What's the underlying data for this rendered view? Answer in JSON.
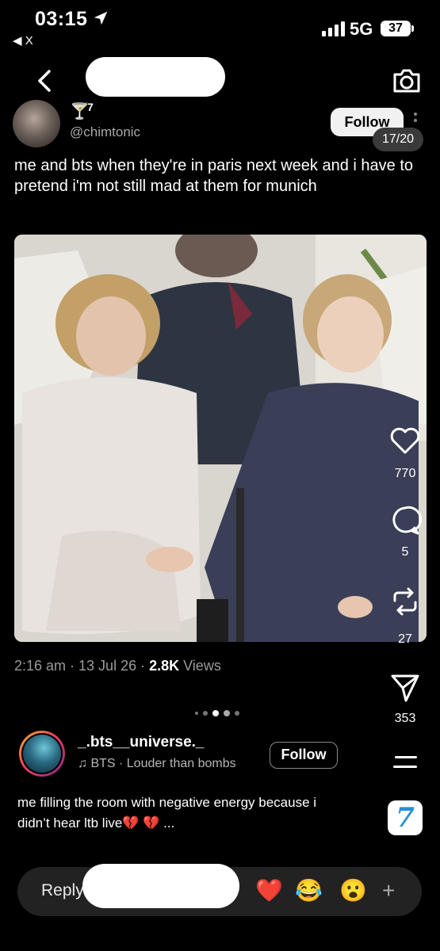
{
  "status_bar": {
    "time": "03:15",
    "back_app": "◀ X",
    "network": "5G",
    "battery": "37"
  },
  "header": {
    "back_icon": "chevron-left-icon",
    "camera_icon": "camera-icon"
  },
  "post": {
    "badge_emoji": "🍸",
    "badge_count": "7",
    "handle": "@chimtonic",
    "follow_label": "Follow",
    "counter": "17/20",
    "caption": "me and bts when they're in paris next week and i have to pretend i'm not still mad at them for munich",
    "timestamp": "2:16 am · 13 Jul 26 · ",
    "views_count": "2.8K",
    "views_label": " Views"
  },
  "actions": {
    "likes": "770",
    "comments": "5",
    "reposts": "27",
    "shares": "353"
  },
  "next_post": {
    "username": "_.bts__universe._",
    "music": "♫ BTS · Louder than bombs",
    "follow_label": "Follow",
    "caption": "me filling the room with negative energy because i didn’t hear ltb live💔 💔  ..."
  },
  "side_app_label": "7",
  "reply_bar": {
    "placeholder": "Reply",
    "emojis": [
      "❤️",
      "😂",
      "😮"
    ],
    "add": "+"
  },
  "colors": {
    "background": "#000000",
    "follow_bg": "#f1f1f1",
    "muted_text": "#9a9a9a",
    "reply_bar_bg": "#222222"
  }
}
